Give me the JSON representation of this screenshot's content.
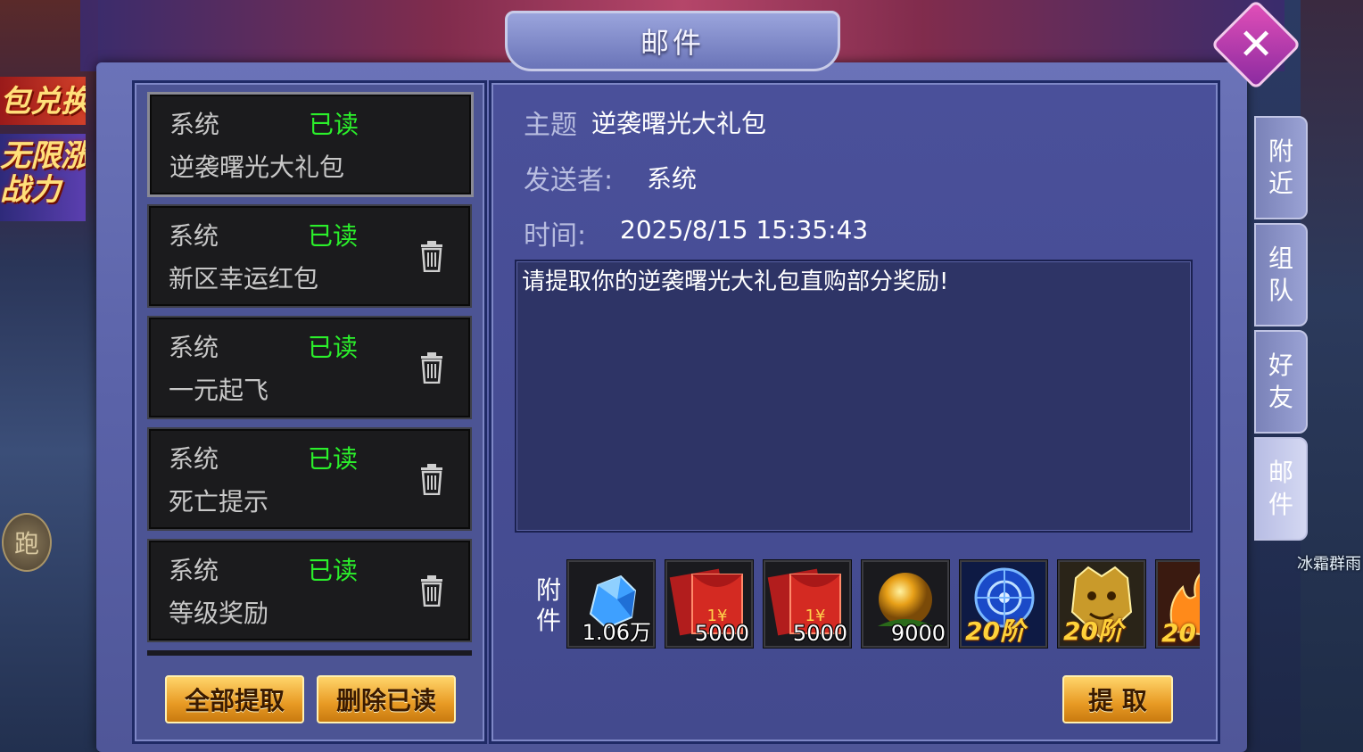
{
  "dialog": {
    "title": "邮件",
    "close_icon": "close-icon"
  },
  "background": {
    "promo_top": "包兑换",
    "promo_mid_1": "无限涨",
    "promo_mid_2": "战力",
    "run_button": "跑",
    "skill_label": "冰霜群雨"
  },
  "mail_list": [
    {
      "sender": "系统",
      "status": "已读",
      "title": "逆袭曙光大礼包",
      "selected": true
    },
    {
      "sender": "系统",
      "status": "已读",
      "title": "新区幸运红包"
    },
    {
      "sender": "系统",
      "status": "已读",
      "title": "一元起飞"
    },
    {
      "sender": "系统",
      "status": "已读",
      "title": "死亡提示"
    },
    {
      "sender": "系统",
      "status": "已读",
      "title": "等级奖励"
    }
  ],
  "list_buttons": {
    "claim_all": "全部提取",
    "delete_read": "删除已读"
  },
  "detail": {
    "subject_label": "主题",
    "subject": "逆袭曙光大礼包",
    "sender_label": "发送者:",
    "sender": "系统",
    "time_label": "时间:",
    "time": "2025/8/15 15:35:43",
    "body": "请提取你的逆袭曙光大礼包直购部分奖励!",
    "attachment_label": "附件",
    "claim_button": "提 取"
  },
  "attachments": [
    {
      "icon": "blue-gem-icon",
      "count": "1.06万"
    },
    {
      "icon": "red-envelope-icon",
      "count": "5000"
    },
    {
      "icon": "red-envelope-icon",
      "count": "5000"
    },
    {
      "icon": "gold-orb-icon",
      "count": "9000"
    },
    {
      "icon": "blue-wheel-icon",
      "tier": "20阶"
    },
    {
      "icon": "golden-beast-icon",
      "tier": "20阶"
    },
    {
      "icon": "fire-item-icon",
      "tier": "20"
    }
  ],
  "side_tabs": [
    {
      "label": "附近"
    },
    {
      "label": "组队"
    },
    {
      "label": "好友"
    },
    {
      "label": "邮件",
      "active": true
    }
  ],
  "colors": {
    "read_status": "#2bef2b",
    "panel": "#4c5494",
    "button_gold": "#e89a24"
  }
}
